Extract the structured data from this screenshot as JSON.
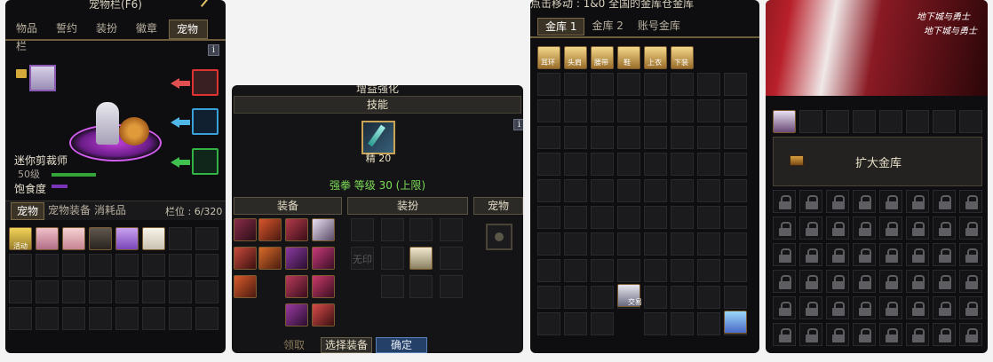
{
  "pet_panel": {
    "title": "宠物栏(F6)",
    "tabs": [
      "物品栏",
      "誓约",
      "装扮",
      "徽章",
      "宠物"
    ],
    "info_label": "i",
    "pet_name": "迷你剪裁师",
    "pet_level": "50级",
    "satiety_label": "饱食度",
    "bottom_tabs": [
      "宠物",
      "宠物装备",
      "消耗品"
    ],
    "slot_count": "栏位 : 6/320",
    "pet_item_caption": "活动"
  },
  "enhance_panel": {
    "title": "增益强化",
    "section_label": "技能",
    "info_label": "i",
    "skill_badge": "精 20",
    "skill_line": "强拳 等级 30 (上限)",
    "col_headers": [
      "装备",
      "装扮",
      "宠物"
    ],
    "select_button": "选择装备",
    "confirm_button": "确定",
    "overlay_text": "领取",
    "avatar_slot_text": "无印"
  },
  "vault_panel": {
    "top_text": "点击移动 : 1&0 全国的金库仓金库",
    "tabs": [
      "金库 1",
      "金库 2",
      "账号金库"
    ],
    "slot_labels": [
      "耳环",
      "头肩",
      "腰带",
      "鞋",
      "上衣",
      "下装"
    ],
    "trade_caption": "交易"
  },
  "expand_panel": {
    "button_label": "扩大金库",
    "banner_logo_top": "地下城与勇士",
    "banner_logo_bottom": "地下城与勇士"
  },
  "colors": {
    "accent_gold": "#e6c46a",
    "green_bar": "#34a53a",
    "purple_bar": "#7a34b8",
    "red_arrow": "#e05050",
    "blue_arrow": "#4fb6e8",
    "green_arrow": "#3fc04f",
    "upper_limit_green": "#7ddc58"
  }
}
